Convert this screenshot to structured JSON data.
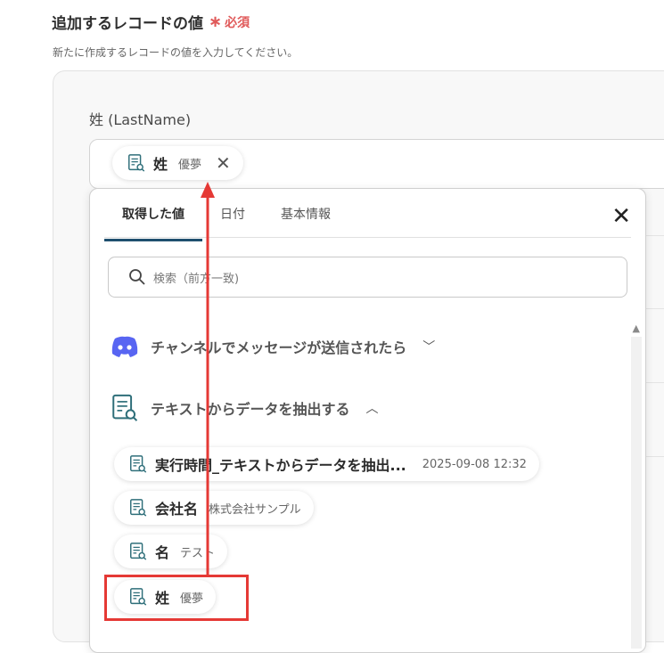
{
  "section": {
    "title": "追加するレコードの値",
    "required": "必須",
    "description": "新たに作成するレコードの値を入力してください。"
  },
  "field": {
    "label": "姓 (LastName)",
    "chip": {
      "name": "姓",
      "value": "優夢"
    }
  },
  "dropdown": {
    "tabs": [
      "取得した値",
      "日付",
      "基本情報"
    ],
    "active_tab": 0,
    "search_placeholder": "検索（前方一致)",
    "groups": [
      {
        "label": "チャンネルでメッセージが送信されたら",
        "icon": "discord-icon",
        "expanded": false
      },
      {
        "label": "テキストからデータを抽出する",
        "icon": "document-search-icon",
        "expanded": true
      }
    ],
    "items": [
      {
        "name": "実行時間_テキストからデータを抽出...",
        "value": "2025-09-08 12:32"
      },
      {
        "name": "会社名",
        "value": "株式会社サンプル"
      },
      {
        "name": "名",
        "value": "テスト"
      },
      {
        "name": "姓",
        "value": "優夢"
      }
    ]
  },
  "colors": {
    "accent": "#1f4f6e",
    "required": "#e05a5a",
    "highlight": "#e53935",
    "discord": "#5865f2"
  }
}
